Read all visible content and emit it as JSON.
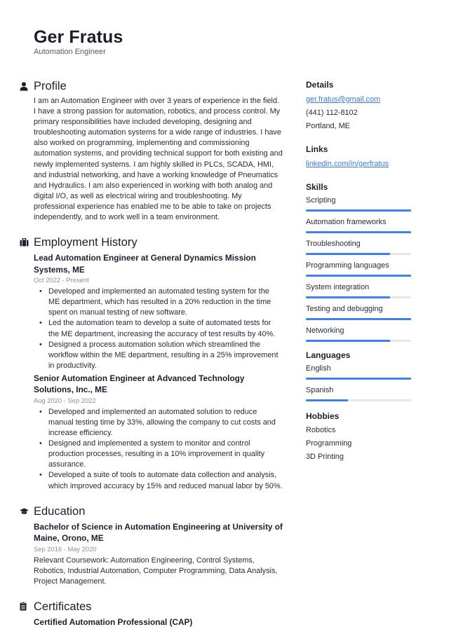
{
  "header": {
    "name": "Ger Fratus",
    "title": "Automation Engineer"
  },
  "profile": {
    "heading": "Profile",
    "icon": "user-icon",
    "text": "I am an Automation Engineer with over 3 years of experience in the field. I have a strong passion for automation, robotics, and process control. My primary responsibilities have included developing, designing and troubleshooting automation systems for a wide range of industries. I have also worked on programming, implementing and commissioning automation systems, and providing technical support for both existing and newly implemented systems. I am highly skilled in PLCs, SCADA, HMI, and industrial networking, and have a working knowledge of Pneumatics and Hydraulics. I am also experienced in working with both analog and digital I/O, as well as electrical wiring and troubleshooting. My professional experience has enabled me to be able to take on projects independently, and to work well in a team environment."
  },
  "employment": {
    "heading": "Employment History",
    "icon": "briefcase-icon",
    "jobs": [
      {
        "title": "Lead Automation Engineer at General Dynamics Mission Systems, ME",
        "dates": "Oct 2022 - Present",
        "bullets": [
          "Developed and implemented an automated testing system for the ME department, which has resulted in a 20% reduction in the time spent on manual testing of new software.",
          "Led the automation team to develop a suite of automated tests for the ME department, increasing the accuracy of test results by 40%.",
          "Designed a process automation solution which streamlined the workflow within the ME department, resulting in a 25% improvement in productivity."
        ]
      },
      {
        "title": "Senior Automation Engineer at Advanced Technology Solutions, Inc., ME",
        "dates": "Aug 2020 - Sep 2022",
        "bullets": [
          "Developed and implemented an automated solution to reduce manual testing time by 33%, allowing the company to cut costs and increase efficiency.",
          "Designed and implemented a system to monitor and control production processes, resulting in a 10% improvement in quality assurance.",
          "Developed a suite of tools to automate data collection and analysis, which improved accuracy by 15% and reduced manual labor by 50%."
        ]
      }
    ]
  },
  "education": {
    "heading": "Education",
    "icon": "graduation-cap-icon",
    "degree": "Bachelor of Science in Automation Engineering at University of Maine, Orono, ME",
    "dates": "Sep 2016 - May 2020",
    "description": "Relevant Coursework: Automation Engineering, Control Systems, Robotics, Industrial Automation, Computer Programming, Data Analysis, Project Management."
  },
  "certificates": {
    "heading": "Certificates",
    "icon": "clipboard-icon",
    "items": [
      "Certified Automation Professional (CAP)"
    ]
  },
  "sidebar": {
    "details": {
      "heading": "Details",
      "email": "ger.fratus@gmail.com",
      "phone": "(441) 112-8102",
      "location": "Portland, ME"
    },
    "links": {
      "heading": "Links",
      "items": [
        "linkedin.com/in/gerfratus"
      ]
    },
    "skills": {
      "heading": "Skills",
      "items": [
        {
          "label": "Scripting",
          "level": 100
        },
        {
          "label": "Automation frameworks",
          "level": 100
        },
        {
          "label": "Troubleshooting",
          "level": 80
        },
        {
          "label": "Programming languages",
          "level": 100
        },
        {
          "label": "System integration",
          "level": 80
        },
        {
          "label": "Testing and debugging",
          "level": 100
        },
        {
          "label": "Networking",
          "level": 80
        }
      ]
    },
    "languages": {
      "heading": "Languages",
      "items": [
        {
          "label": "English",
          "level": 100
        },
        {
          "label": "Spanish",
          "level": 40
        }
      ]
    },
    "hobbies": {
      "heading": "Hobbies",
      "items": [
        "Robotics",
        "Programming",
        "3D Printing"
      ]
    }
  },
  "colors": {
    "accent": "#3b82f0",
    "link": "#3a7bd5",
    "bar_track": "#e4e6ea"
  }
}
